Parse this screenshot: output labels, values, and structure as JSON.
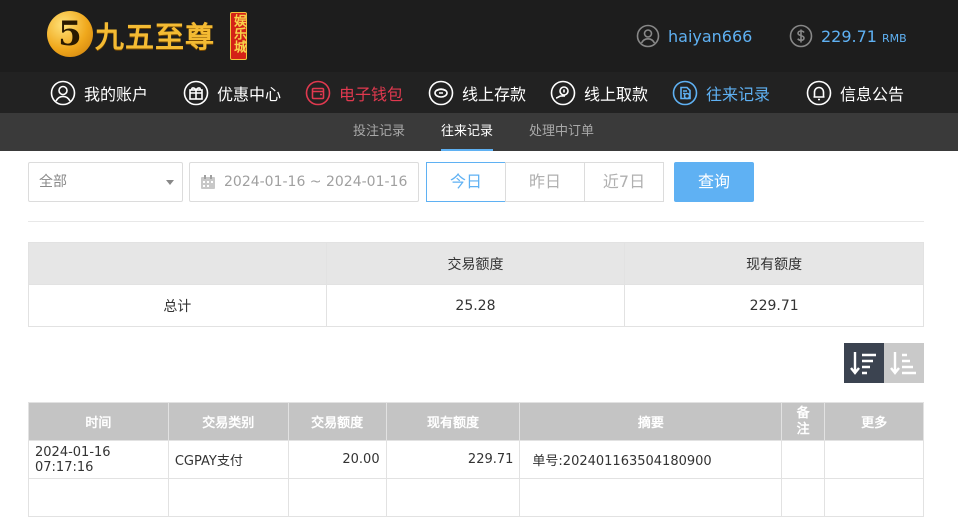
{
  "brand": {
    "logo_mark": "5",
    "name": "九五至尊",
    "badge": "娱乐城"
  },
  "user": {
    "username": "haiyan666",
    "balance": "229.71",
    "currency": "RMB"
  },
  "nav": [
    {
      "label": "我的账户",
      "icon": "user-icon"
    },
    {
      "label": "优惠中心",
      "icon": "gift-icon"
    },
    {
      "label": "电子钱包",
      "icon": "wallet-icon"
    },
    {
      "label": "线上存款",
      "icon": "deposit-icon"
    },
    {
      "label": "线上取款",
      "icon": "withdraw-icon"
    },
    {
      "label": "往来记录",
      "icon": "records-icon"
    },
    {
      "label": "信息公告",
      "icon": "bell-icon"
    }
  ],
  "subnav": [
    {
      "label": "投注记录"
    },
    {
      "label": "往来记录"
    },
    {
      "label": "处理中订单"
    }
  ],
  "filters": {
    "type_select": "全部",
    "date_range": "2024-01-16 ~ 2024-01-16",
    "quick_ranges": [
      "今日",
      "昨日",
      "近7日"
    ],
    "query_button": "查询"
  },
  "summary": {
    "headers": [
      "",
      "交易额度",
      "现有额度"
    ],
    "row": {
      "label": "总计",
      "amount": "25.28",
      "balance": "229.71"
    }
  },
  "records": {
    "headers": [
      "时间",
      "交易类别",
      "交易额度",
      "现有额度",
      "摘要",
      "备注",
      "更多"
    ],
    "rows": [
      {
        "time": "2024-01-16 07:17:16",
        "type": "CGPAY支付",
        "amount": "20.00",
        "balance": "229.71",
        "summary": "单号:2024011635041809​00",
        "note": "",
        "more": ""
      }
    ]
  },
  "colors": {
    "accent": "#5fb1f3",
    "nav_bg": "#222222",
    "header_bg": "#1d1d1d",
    "wallet_red": "#e0394f"
  }
}
